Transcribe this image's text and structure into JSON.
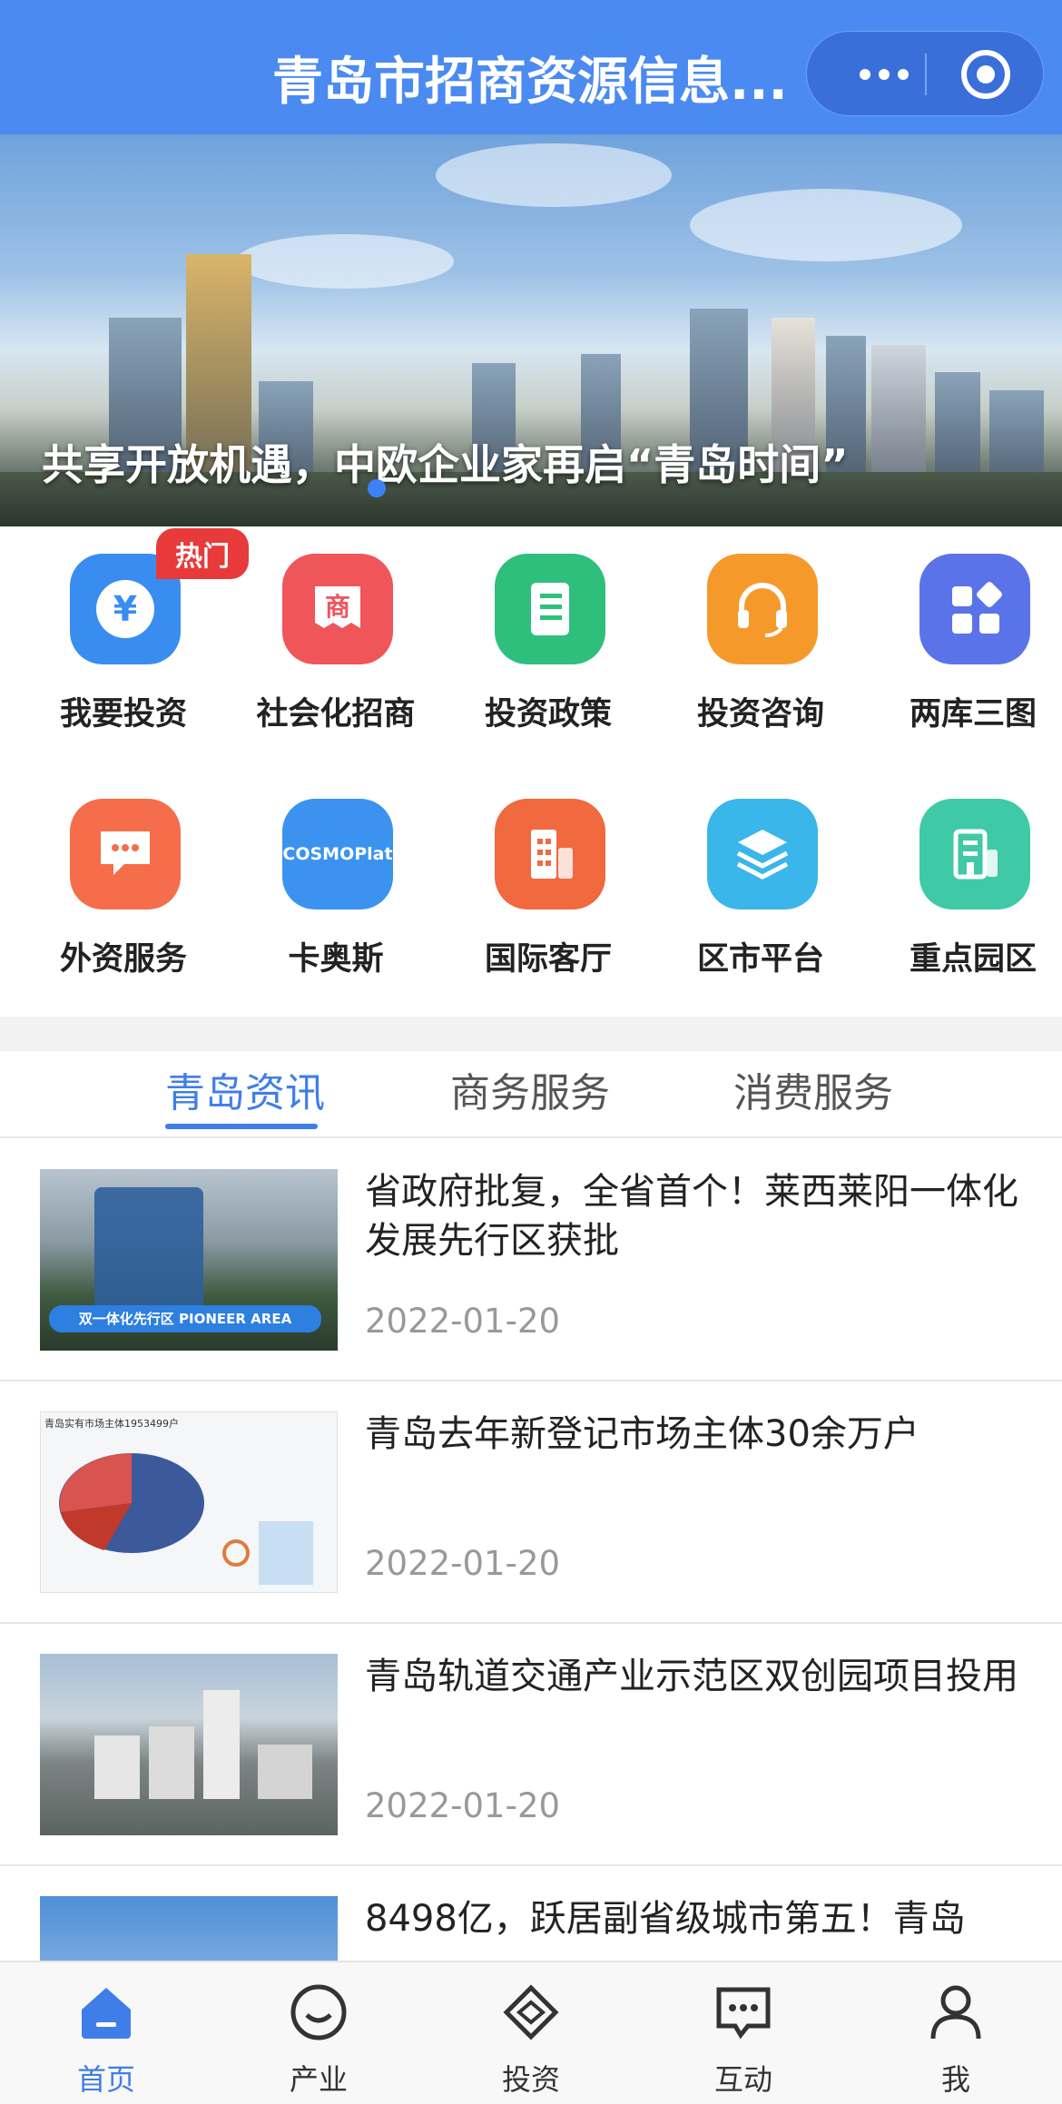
{
  "header": {
    "title": "青岛市招商资源信息..."
  },
  "banner": {
    "caption": "共享开放机遇，中欧企业家再启“青岛时间”"
  },
  "grid": {
    "hot_badge": "热门",
    "row1": [
      {
        "label": "我要投资",
        "icon": "yen-icon",
        "color": "#3a8df0"
      },
      {
        "label": "社会化招商",
        "icon": "shop-icon",
        "color": "#f0555a"
      },
      {
        "label": "投资政策",
        "icon": "document-icon",
        "color": "#2fbf7d"
      },
      {
        "label": "投资咨询",
        "icon": "headset-icon",
        "color": "#f59a2a"
      },
      {
        "label": "两库三图",
        "icon": "apps-icon",
        "color": "#5b73e8"
      }
    ],
    "row2": [
      {
        "label": "外资服务",
        "icon": "chat-icon",
        "color": "#f56d4a"
      },
      {
        "label": "卡奥斯",
        "icon": "cosmoplat-icon",
        "color": "#3b93ef",
        "text": "COSMOPlat"
      },
      {
        "label": "国际客厅",
        "icon": "building-icon",
        "color": "#f0693f"
      },
      {
        "label": "区市平台",
        "icon": "layers-icon",
        "color": "#3ab6ea"
      },
      {
        "label": "重点园区",
        "icon": "park-icon",
        "color": "#40c9a6"
      }
    ]
  },
  "tabs": {
    "items": [
      "青岛资讯",
      "商务服务",
      "消费服务"
    ],
    "active": "青岛资讯"
  },
  "news": [
    {
      "title": "省政府批复，全省首个！莱西莱阳一体化发展先行区获批",
      "date": "2022-01-20",
      "thumb_text": "双一体化先行区 PIONEER AREA"
    },
    {
      "title": "青岛去年新登记市场主体30余万户",
      "date": "2022-01-20",
      "thumb_text": "青岛实有市场主体1953499户"
    },
    {
      "title": "青岛轨道交通产业示范区双创园项目投用",
      "date": "2022-01-20"
    },
    {
      "title": "8498亿，跃居副省级城市第五！青岛",
      "date": ""
    }
  ],
  "bottom_nav": [
    {
      "label": "首页",
      "icon": "home-icon",
      "active": true
    },
    {
      "label": "产业",
      "icon": "smile-icon",
      "active": false
    },
    {
      "label": "投资",
      "icon": "handshake-icon",
      "active": false
    },
    {
      "label": "互动",
      "icon": "message-icon",
      "active": false
    },
    {
      "label": "我",
      "icon": "user-icon",
      "active": false
    }
  ]
}
